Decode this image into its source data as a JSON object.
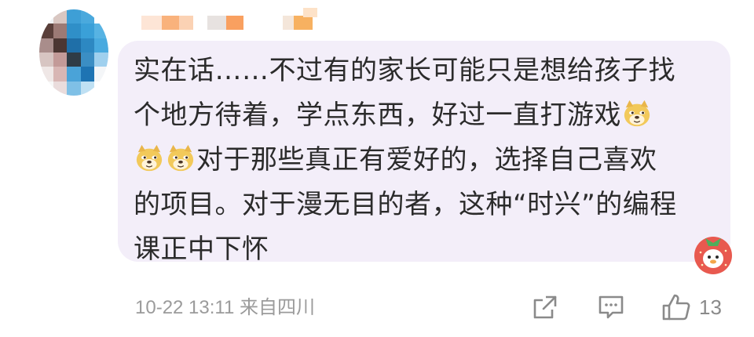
{
  "comment": {
    "lines": [
      "实在话……不过有的家长可能只是想给孩子找",
      "个地方待着，学点东西，好过一直打游戏",
      "对于那些真正有爱好的，选择自己喜欢",
      "的项目。对于漫无目的者，这种“时兴”的编程",
      "课正中下怀"
    ],
    "emoji_icon": "doge-emoji"
  },
  "meta": {
    "timestamp": "10-22 13:11",
    "location": "来自四川"
  },
  "actions": {
    "like_count": "13"
  },
  "colors": {
    "bubble_bg": "#f3eef9",
    "text": "#2b2b2b",
    "meta_text": "#9b9b9b",
    "icon": "#8a8a8a"
  }
}
